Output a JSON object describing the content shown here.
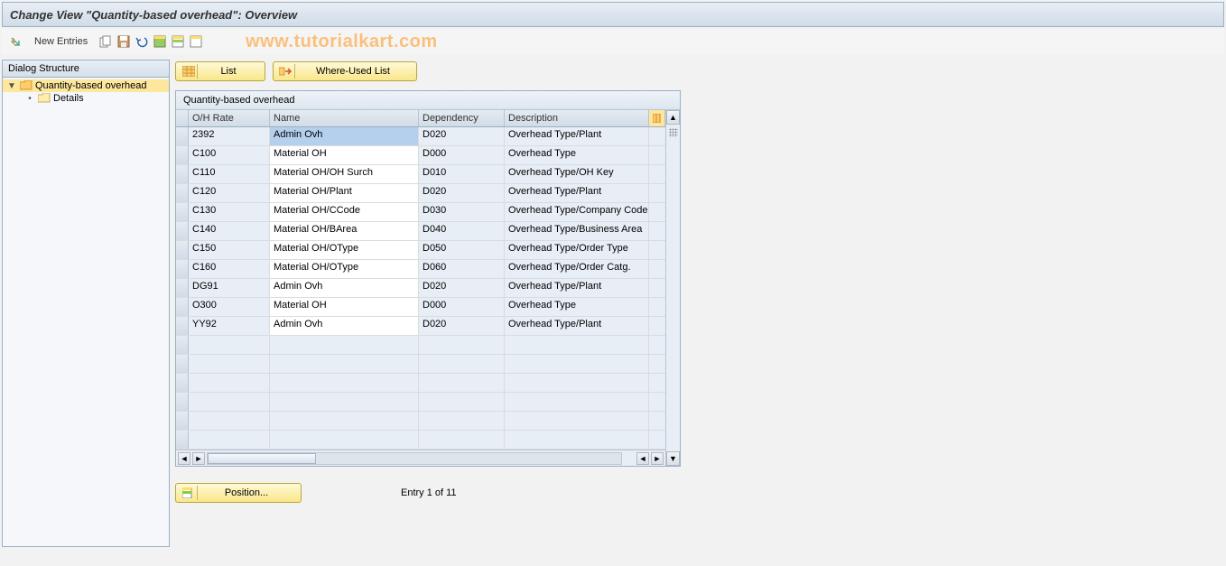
{
  "title": "Change View \"Quantity-based overhead\": Overview",
  "toolbar": {
    "new_entries_label": "New Entries"
  },
  "watermark": "www.tutorialkart.com",
  "sidebar": {
    "header": "Dialog Structure",
    "items": [
      {
        "label": "Quantity-based overhead",
        "selected": true,
        "open": true,
        "level": 0
      },
      {
        "label": "Details",
        "selected": false,
        "open": false,
        "level": 1
      }
    ]
  },
  "buttons": {
    "list": "List",
    "where_used": "Where-Used List",
    "position": "Position..."
  },
  "panel_title": "Quantity-based overhead",
  "columns": {
    "rate": "O/H Rate",
    "name": "Name",
    "dep": "Dependency",
    "desc": "Description"
  },
  "rows": [
    {
      "rate": "2392",
      "name": "Admin Ovh",
      "dep": "D020",
      "desc": "Overhead Type/Plant",
      "name_selected": true
    },
    {
      "rate": "C100",
      "name": "Material OH",
      "dep": "D000",
      "desc": "Overhead Type"
    },
    {
      "rate": "C110",
      "name": "Material OH/OH Surch",
      "dep": "D010",
      "desc": "Overhead Type/OH Key"
    },
    {
      "rate": "C120",
      "name": "Material OH/Plant",
      "dep": "D020",
      "desc": "Overhead Type/Plant"
    },
    {
      "rate": "C130",
      "name": "Material OH/CCode",
      "dep": "D030",
      "desc": "Overhead Type/Company Code"
    },
    {
      "rate": "C140",
      "name": "Material OH/BArea",
      "dep": "D040",
      "desc": "Overhead Type/Business Area"
    },
    {
      "rate": "C150",
      "name": "Material OH/OType",
      "dep": "D050",
      "desc": "Overhead Type/Order Type"
    },
    {
      "rate": "C160",
      "name": "Material OH/OType",
      "dep": "D060",
      "desc": "Overhead Type/Order Catg."
    },
    {
      "rate": "DG91",
      "name": "Admin Ovh",
      "dep": "D020",
      "desc": "Overhead Type/Plant"
    },
    {
      "rate": "O300",
      "name": "Material OH",
      "dep": "D000",
      "desc": "Overhead Type"
    },
    {
      "rate": "YY92",
      "name": "Admin Ovh",
      "dep": "D020",
      "desc": "Overhead Type/Plant"
    }
  ],
  "empty_rows": 6,
  "status": "Entry 1 of 11"
}
